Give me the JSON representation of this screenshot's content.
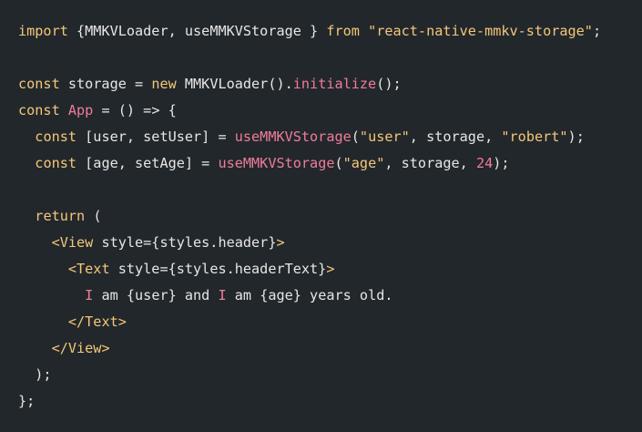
{
  "colors": {
    "background": "#22272b",
    "plain": "#e6e6e6",
    "keyword": "#f4c77a",
    "function": "#ef7c9a",
    "string": "#f4c77a",
    "number": "#ef7c9a",
    "tag": "#f4c77a"
  },
  "code": {
    "lines": [
      {
        "tokens": [
          {
            "text": "import",
            "kind": "keyword"
          },
          {
            "text": " {MMKVLoader, useMMKVStorage } ",
            "kind": "plain"
          },
          {
            "text": "from",
            "kind": "keyword"
          },
          {
            "text": " ",
            "kind": "plain"
          },
          {
            "text": "\"react-native-mmkv-storage\"",
            "kind": "string"
          },
          {
            "text": ";",
            "kind": "plain"
          }
        ]
      },
      {
        "tokens": []
      },
      {
        "tokens": [
          {
            "text": "const",
            "kind": "keyword"
          },
          {
            "text": " storage = ",
            "kind": "plain"
          },
          {
            "text": "new",
            "kind": "keyword"
          },
          {
            "text": " MMKVLoader().",
            "kind": "plain"
          },
          {
            "text": "initialize",
            "kind": "function"
          },
          {
            "text": "();",
            "kind": "plain"
          }
        ]
      },
      {
        "tokens": [
          {
            "text": "const",
            "kind": "keyword"
          },
          {
            "text": " ",
            "kind": "plain"
          },
          {
            "text": "App",
            "kind": "function"
          },
          {
            "text": " = () => {",
            "kind": "plain"
          }
        ]
      },
      {
        "tokens": [
          {
            "text": "  ",
            "kind": "plain"
          },
          {
            "text": "const",
            "kind": "keyword"
          },
          {
            "text": " [user, setUser] = ",
            "kind": "plain"
          },
          {
            "text": "useMMKVStorage",
            "kind": "function"
          },
          {
            "text": "(",
            "kind": "plain"
          },
          {
            "text": "\"user\"",
            "kind": "string"
          },
          {
            "text": ", storage, ",
            "kind": "plain"
          },
          {
            "text": "\"robert\"",
            "kind": "string"
          },
          {
            "text": ");",
            "kind": "plain"
          }
        ]
      },
      {
        "tokens": [
          {
            "text": "  ",
            "kind": "plain"
          },
          {
            "text": "const",
            "kind": "keyword"
          },
          {
            "text": " [age, setAge] = ",
            "kind": "plain"
          },
          {
            "text": "useMMKVStorage",
            "kind": "function"
          },
          {
            "text": "(",
            "kind": "plain"
          },
          {
            "text": "\"age\"",
            "kind": "string"
          },
          {
            "text": ", storage, ",
            "kind": "plain"
          },
          {
            "text": "24",
            "kind": "number"
          },
          {
            "text": ");",
            "kind": "plain"
          }
        ]
      },
      {
        "tokens": []
      },
      {
        "tokens": [
          {
            "text": "  ",
            "kind": "plain"
          },
          {
            "text": "return",
            "kind": "keyword"
          },
          {
            "text": " (",
            "kind": "plain"
          }
        ]
      },
      {
        "tokens": [
          {
            "text": "    ",
            "kind": "plain"
          },
          {
            "text": "<View",
            "kind": "tag"
          },
          {
            "text": " style={styles.header}",
            "kind": "plain"
          },
          {
            "text": ">",
            "kind": "tag"
          }
        ]
      },
      {
        "tokens": [
          {
            "text": "      ",
            "kind": "plain"
          },
          {
            "text": "<Text",
            "kind": "tag"
          },
          {
            "text": " style={styles.headerText}",
            "kind": "plain"
          },
          {
            "text": ">",
            "kind": "tag"
          }
        ]
      },
      {
        "tokens": [
          {
            "text": "        ",
            "kind": "plain"
          },
          {
            "text": "I",
            "kind": "function"
          },
          {
            "text": " am {user} and ",
            "kind": "plain"
          },
          {
            "text": "I",
            "kind": "function"
          },
          {
            "text": " am {age} years old.",
            "kind": "plain"
          }
        ]
      },
      {
        "tokens": [
          {
            "text": "      ",
            "kind": "plain"
          },
          {
            "text": "</Text>",
            "kind": "tag"
          }
        ]
      },
      {
        "tokens": [
          {
            "text": "    ",
            "kind": "plain"
          },
          {
            "text": "</View>",
            "kind": "tag"
          }
        ]
      },
      {
        "tokens": [
          {
            "text": "  );",
            "kind": "plain"
          }
        ]
      },
      {
        "tokens": [
          {
            "text": "};",
            "kind": "plain"
          }
        ]
      }
    ]
  }
}
